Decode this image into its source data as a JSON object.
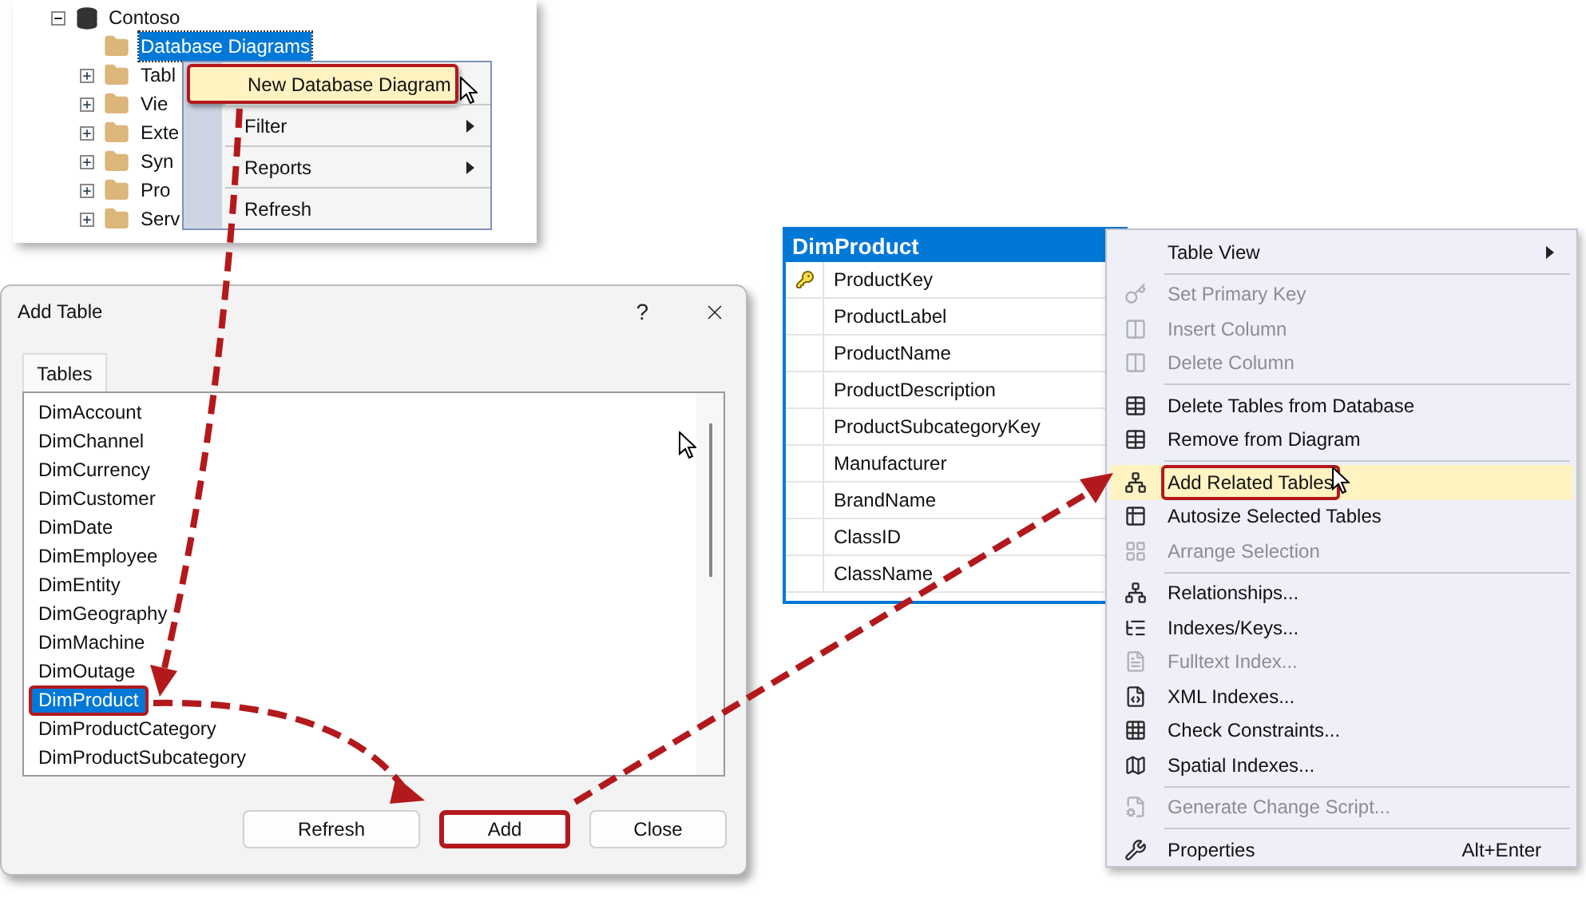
{
  "explorer": {
    "database": {
      "label": "Contoso",
      "expanded": true
    },
    "items": [
      {
        "label": "Database Diagrams",
        "selected": true,
        "expandable": false
      },
      {
        "label": "Tabl",
        "selected": false,
        "expandable": true
      },
      {
        "label": "Vie",
        "selected": false,
        "expandable": true
      },
      {
        "label": "Exte",
        "selected": false,
        "expandable": true
      },
      {
        "label": "Syn",
        "selected": false,
        "expandable": true
      },
      {
        "label": "Pro",
        "selected": false,
        "expandable": true
      },
      {
        "label": "Serv",
        "selected": false,
        "expandable": true
      }
    ]
  },
  "context_menu": {
    "items": [
      {
        "label": "New Database Diagram",
        "selected": true,
        "callout": true,
        "submenu": false
      },
      {
        "label": "Filter",
        "selected": false,
        "callout": false,
        "submenu": true
      },
      {
        "label": "Reports",
        "selected": false,
        "callout": false,
        "submenu": true
      },
      {
        "label": "Refresh",
        "selected": false,
        "callout": false,
        "submenu": false
      }
    ]
  },
  "add_table_dialog": {
    "title": "Add Table",
    "help": "?",
    "tabs": [
      {
        "label": "Tables",
        "selected": true
      }
    ],
    "tables": [
      {
        "label": "DimAccount",
        "selected": false,
        "callout": false
      },
      {
        "label": "DimChannel",
        "selected": false,
        "callout": false
      },
      {
        "label": "DimCurrency",
        "selected": false,
        "callout": false
      },
      {
        "label": "DimCustomer",
        "selected": false,
        "callout": false
      },
      {
        "label": "DimDate",
        "selected": false,
        "callout": false
      },
      {
        "label": "DimEmployee",
        "selected": false,
        "callout": false
      },
      {
        "label": "DimEntity",
        "selected": false,
        "callout": false
      },
      {
        "label": "DimGeography",
        "selected": false,
        "callout": false
      },
      {
        "label": "DimMachine",
        "selected": false,
        "callout": false
      },
      {
        "label": "DimOutage",
        "selected": false,
        "callout": false
      },
      {
        "label": "DimProduct",
        "selected": true,
        "callout": true
      },
      {
        "label": "DimProductCategory",
        "selected": false,
        "callout": false
      },
      {
        "label": "DimProductSubcategory",
        "selected": false,
        "callout": false
      }
    ],
    "buttons": [
      {
        "label": "Refresh",
        "callout": false
      },
      {
        "label": "Add",
        "callout": true
      },
      {
        "label": "Close",
        "callout": false
      }
    ]
  },
  "table_designer": {
    "title": "DimProduct",
    "columns": [
      {
        "name": "ProductKey",
        "primary_key": true
      },
      {
        "name": "ProductLabel",
        "primary_key": false
      },
      {
        "name": "ProductName",
        "primary_key": false
      },
      {
        "name": "ProductDescription",
        "primary_key": false
      },
      {
        "name": "ProductSubcategoryKey",
        "primary_key": false
      },
      {
        "name": "Manufacturer",
        "primary_key": false
      },
      {
        "name": "BrandName",
        "primary_key": false
      },
      {
        "name": "ClassID",
        "primary_key": false
      },
      {
        "name": "ClassName",
        "primary_key": false
      }
    ]
  },
  "diagram_menu": {
    "items": [
      {
        "kind": "item",
        "label": "Table View",
        "disabled": false,
        "selected": false,
        "callout": false,
        "submenu": true
      },
      {
        "kind": "separator"
      },
      {
        "kind": "item",
        "label": "Set Primary Key",
        "disabled": true,
        "selected": false,
        "callout": false,
        "submenu": false
      },
      {
        "kind": "item",
        "label": "Insert Column",
        "disabled": true,
        "selected": false,
        "callout": false,
        "submenu": false
      },
      {
        "kind": "item",
        "label": "Delete Column",
        "disabled": true,
        "selected": false,
        "callout": false,
        "submenu": false
      },
      {
        "kind": "separator"
      },
      {
        "kind": "item",
        "label": "Delete Tables from Database",
        "disabled": false,
        "selected": false,
        "callout": false,
        "submenu": false
      },
      {
        "kind": "item",
        "label": "Remove from Diagram",
        "disabled": false,
        "selected": false,
        "callout": false,
        "submenu": false
      },
      {
        "kind": "separator"
      },
      {
        "kind": "item",
        "label": "Add Related Tables",
        "disabled": false,
        "selected": true,
        "callout": true,
        "submenu": false
      },
      {
        "kind": "item",
        "label": "Autosize Selected Tables",
        "disabled": false,
        "selected": false,
        "callout": false,
        "submenu": false
      },
      {
        "kind": "item",
        "label": "Arrange Selection",
        "disabled": true,
        "selected": false,
        "callout": false,
        "submenu": false
      },
      {
        "kind": "separator"
      },
      {
        "kind": "item",
        "label": "Relationships...",
        "disabled": false,
        "selected": false,
        "callout": false,
        "submenu": false
      },
      {
        "kind": "item",
        "label": "Indexes/Keys...",
        "disabled": false,
        "selected": false,
        "callout": false,
        "submenu": false
      },
      {
        "kind": "item",
        "label": "Fulltext Index...",
        "disabled": true,
        "selected": false,
        "callout": false,
        "submenu": false
      },
      {
        "kind": "item",
        "label": "XML Indexes...",
        "disabled": false,
        "selected": false,
        "callout": false,
        "submenu": false
      },
      {
        "kind": "item",
        "label": "Check Constraints...",
        "disabled": false,
        "selected": false,
        "callout": false,
        "submenu": false
      },
      {
        "kind": "item",
        "label": "Spatial Indexes...",
        "disabled": false,
        "selected": false,
        "callout": false,
        "submenu": false
      },
      {
        "kind": "separator"
      },
      {
        "kind": "item",
        "label": "Generate Change Script...",
        "disabled": true,
        "selected": false,
        "callout": false,
        "submenu": false
      },
      {
        "kind": "separator"
      },
      {
        "kind": "item",
        "label": "Properties",
        "disabled": false,
        "selected": false,
        "callout": false,
        "submenu": false,
        "shortcut": "Alt+Enter"
      }
    ]
  }
}
